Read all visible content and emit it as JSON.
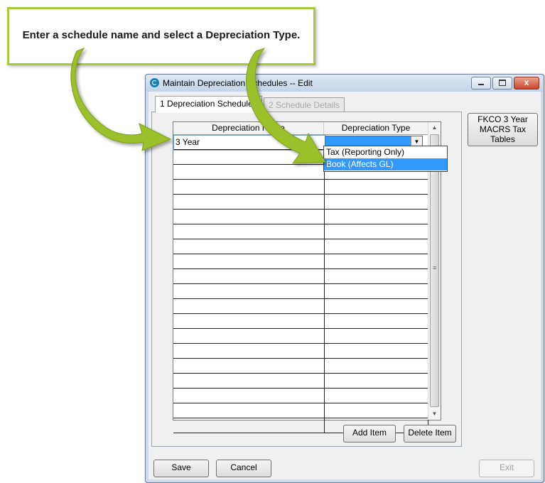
{
  "callout": {
    "text": "Enter a schedule name and select a Depreciation Type."
  },
  "window": {
    "title": "Maintain Depreciation Schedules -- Edit",
    "controls": {
      "minimize": "",
      "maximize": "",
      "close": "x"
    }
  },
  "tabs": [
    {
      "label": "1 Depreciation Schedules",
      "active": true
    },
    {
      "label": "2 Schedule Details",
      "active": false
    }
  ],
  "grid": {
    "columns": [
      "Depreciation Name",
      "Depreciation Type"
    ],
    "first_row": {
      "name": "3 Year",
      "type": ""
    },
    "empty_rows": 19
  },
  "dropdown": {
    "options": [
      "Tax (Reporting Only)",
      "Book (Affects GL)"
    ],
    "highlighted": "Book (Affects GL)"
  },
  "side_button": {
    "line1": "FKCO 3 Year",
    "line2": "MACRS Tax",
    "line3": "Tables"
  },
  "buttons": {
    "add_item": "Add Item",
    "delete_item": "Delete Item",
    "save": "Save",
    "cancel": "Cancel",
    "exit": "Exit"
  },
  "colors": {
    "callout_border": "#a6c93a",
    "arrow": "#9bc02b",
    "selection": "#3399ff"
  }
}
